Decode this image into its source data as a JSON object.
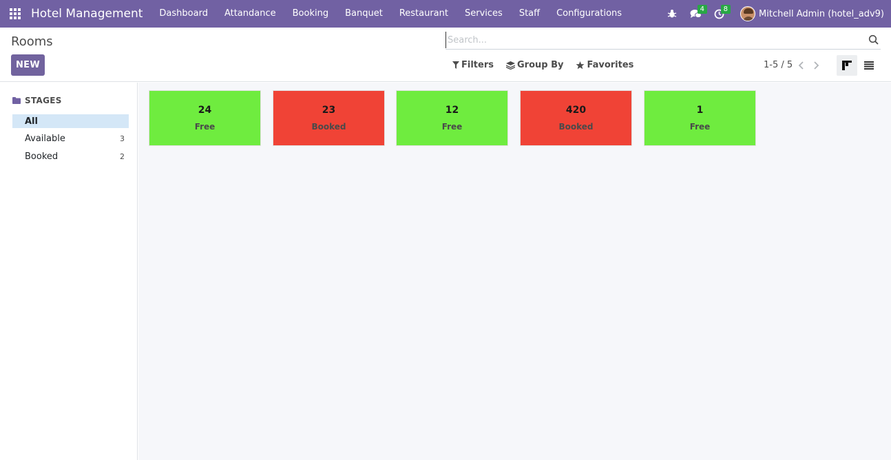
{
  "navbar": {
    "brand": "Hotel Management",
    "menu": [
      "Dashboard",
      "Attandance",
      "Booking",
      "Banquet",
      "Restaurant",
      "Services",
      "Staff",
      "Configurations"
    ],
    "messages_badge": "4",
    "activities_badge": "8",
    "user_name": "Mitchell Admin (hotel_adv9)"
  },
  "control": {
    "breadcrumb": "Rooms",
    "new_label": "NEW",
    "search_placeholder": "Search...",
    "filters_label": "Filters",
    "groupby_label": "Group By",
    "favorites_label": "Favorites",
    "pager": "1-5 / 5"
  },
  "sidebar": {
    "heading": "STAGES",
    "items": [
      {
        "label": "All",
        "count": ""
      },
      {
        "label": "Available",
        "count": "3"
      },
      {
        "label": "Booked",
        "count": "2"
      }
    ]
  },
  "rooms": [
    {
      "number": "24",
      "status": "Free",
      "color": "#6fec3f"
    },
    {
      "number": "23",
      "status": "Booked",
      "color": "#f04336"
    },
    {
      "number": "12",
      "status": "Free",
      "color": "#6fec3f"
    },
    {
      "number": "420",
      "status": "Booked",
      "color": "#f04336"
    },
    {
      "number": "1",
      "status": "Free",
      "color": "#6fec3f"
    }
  ],
  "colors": {
    "navbar": "#7161a3",
    "primary_button": "#71639e",
    "free": "#6fec3f",
    "booked": "#f04336",
    "active_stage": "#d4e7f7"
  }
}
